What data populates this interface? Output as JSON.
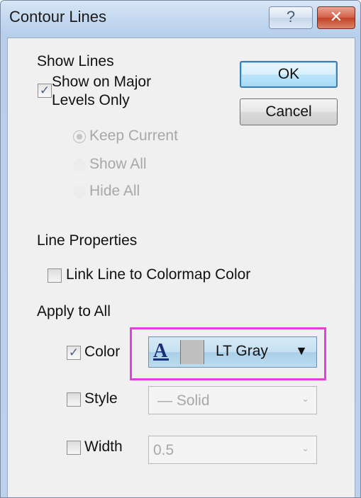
{
  "window": {
    "title": "Contour Lines",
    "help_label": "?",
    "close_label": "✕"
  },
  "show_lines": {
    "heading": "Show Lines",
    "major_only_label_1": "Show on Major",
    "major_only_label_2": "Levels Only",
    "major_only_checked": true,
    "radios": [
      {
        "label": "Keep Current",
        "selected": true
      },
      {
        "label": "Show All",
        "selected": false
      },
      {
        "label": "Hide All",
        "selected": false
      }
    ]
  },
  "buttons": {
    "ok": "OK",
    "cancel": "Cancel"
  },
  "line_properties": {
    "heading": "Line Properties",
    "link_label": "Link Line to Colormap Color",
    "link_checked": false
  },
  "apply_to_all": {
    "heading": "Apply to All",
    "color": {
      "label": "Color",
      "checked": true,
      "value": "LT Gray",
      "icon": "font-a-icon",
      "swatch": "#c0c0c0"
    },
    "style": {
      "label": "Style",
      "checked": false,
      "value": "— Solid"
    },
    "width": {
      "label": "Width",
      "checked": false,
      "value": "0.5"
    }
  },
  "colors": {
    "highlight": "#e83ee0",
    "ok_border": "#3c7fb1",
    "title_bar": "#c2d7ef",
    "disabled_text": "#a8a8a8"
  }
}
